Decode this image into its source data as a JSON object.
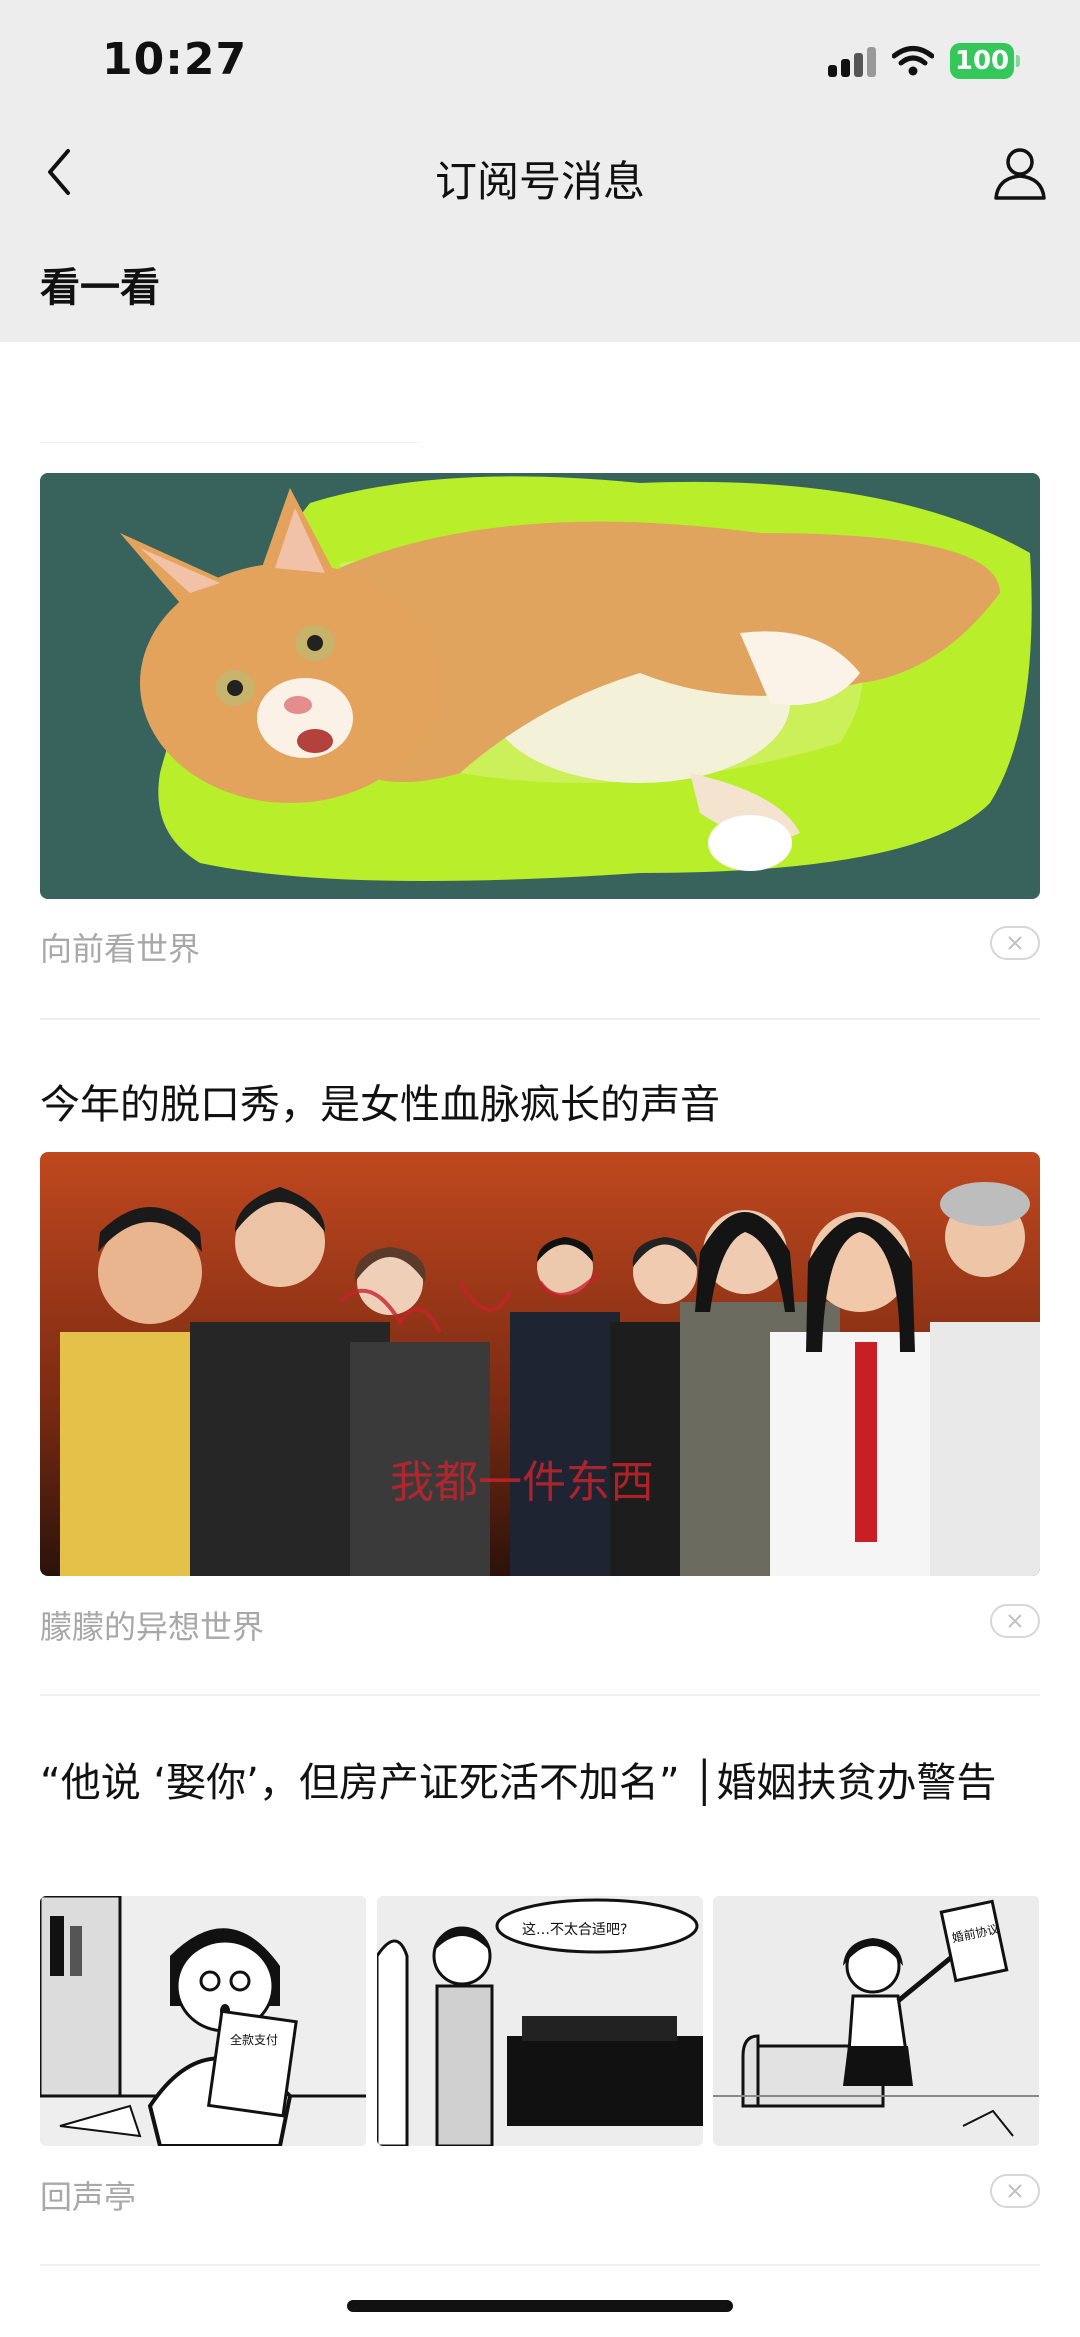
{
  "status": {
    "time": "10:27",
    "battery": "100"
  },
  "nav": {
    "title": "订阅号消息"
  },
  "section": {
    "label": "看一看"
  },
  "cards": [
    {
      "source": "向前看世界"
    },
    {
      "title": "今年的脱口秀，是女性血脉疯长的声音",
      "source": "朦朦的异想世界",
      "overlay_text": "我都一件东西"
    },
    {
      "title": "“他说 ‘娶你’，但房产证死活不加名” │婚姻扶贫办警告",
      "source": "回声亭",
      "panel_texts": {
        "doc": "全款支付",
        "bubble": "这…不太合适吧?",
        "sign": "婚前协议"
      }
    }
  ],
  "colors": {
    "battery": "#34c759",
    "header_bg": "#ededed",
    "cat_bed": "#b9ee2a"
  }
}
